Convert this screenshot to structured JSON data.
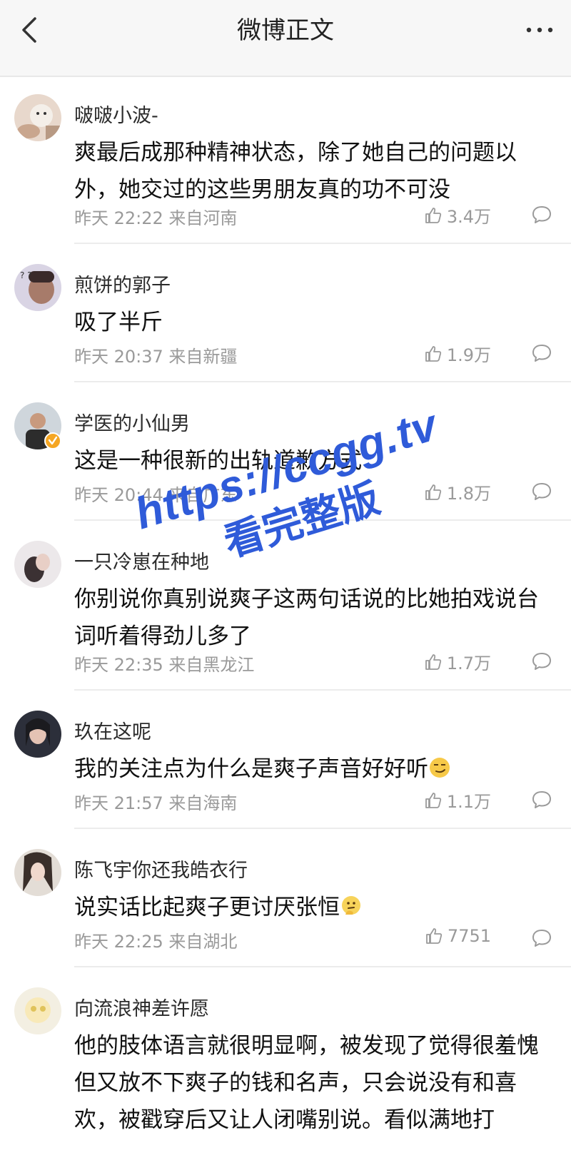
{
  "header": {
    "title": "微博正文"
  },
  "comments": [
    {
      "username": "啵啵小波-",
      "text": "爽最后成那种精神状态，除了她自己的问题以外，她交过的这些男朋友真的功不可没",
      "time": "昨天 22:22 来自河南",
      "likes": "3.4万",
      "verified": false
    },
    {
      "username": "煎饼的郭子",
      "text": "吸了半斤",
      "time": "昨天 20:37 来自新疆",
      "likes": "1.9万",
      "verified": false
    },
    {
      "username": "学医的小仙男",
      "text": "这是一种很新的出轨道歉方式",
      "time": "昨天 20:44 来自广东",
      "likes": "1.8万",
      "verified": true
    },
    {
      "username": "一只冷崽在种地",
      "text": "你别说你真别说爽子这两句话说的比她拍戏说台词听着得劲儿多了",
      "time": "昨天 22:35 来自黑龙江",
      "likes": "1.7万",
      "verified": false
    },
    {
      "username": "玖在这呢",
      "text": "我的关注点为什么是爽子声音好好听",
      "time": "昨天 21:57 来自海南",
      "likes": "1.1万",
      "verified": false,
      "emoji": "smirk-emoji"
    },
    {
      "username": "陈飞宇你还我皓衣行",
      "text": "说实话比起爽子更讨厌张恒",
      "time": "昨天 22:25 来自湖北",
      "likes": "7751",
      "verified": false,
      "emoji": "thinking-emoji"
    },
    {
      "username": "向流浪神差许愿",
      "text": "他的肢体语言就很明显啊，被发现了觉得很羞愧但又放不下爽子的钱和名声，只会说没有和喜欢，被戳穿后又让人闭嘴别说。看似满地打",
      "verified": false
    }
  ],
  "watermark": {
    "line1": "https://ccgg.tv",
    "line2": "看完整版"
  },
  "icons": {
    "back": "chevron-left-icon",
    "more": "more-dots-icon",
    "like": "thumbs-up-icon",
    "reply": "comment-bubble-icon",
    "verified": "verified-badge-icon"
  },
  "colors": {
    "meta_text": "#9a9a9a",
    "verified_badge": "#f5a623",
    "watermark": "#2f5bd9"
  }
}
